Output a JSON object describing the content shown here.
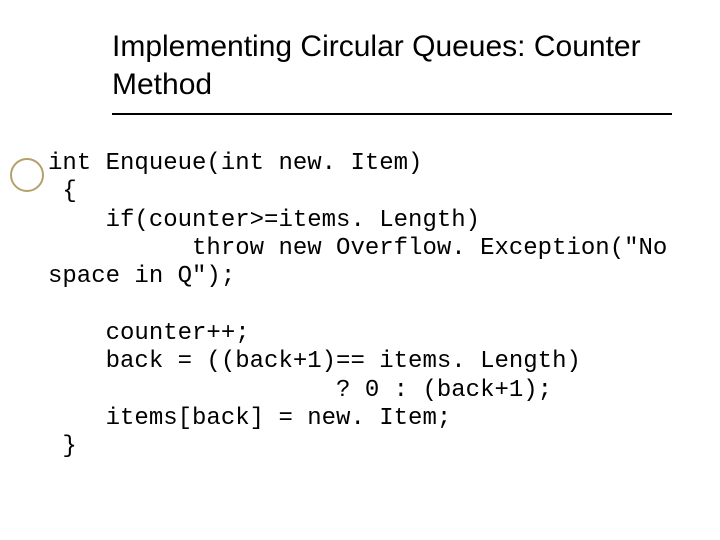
{
  "title": "Implementing Circular Queues: Counter Method",
  "code": {
    "l1": "int Enqueue(int new. Item)",
    "l2": " {",
    "l3": "    if(counter>=items. Length)",
    "l4": "          throw new Overflow. Exception(\"No",
    "l5": "space in Q\");",
    "l6": "",
    "l7": "    counter++;",
    "l8": "    back = ((back+1)== items. Length)",
    "l9": "                    ? 0 : (back+1);",
    "l10": "    items[back] = new. Item;",
    "l11": " }"
  }
}
